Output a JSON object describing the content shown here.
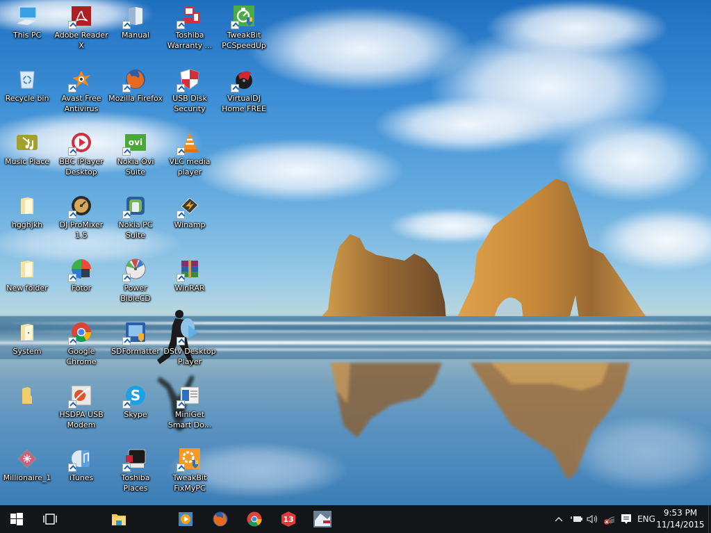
{
  "desktop": {
    "icons": [
      {
        "id": "this-pc",
        "label": "This PC",
        "shortcut": false
      },
      {
        "id": "adobe-reader",
        "label": "Adobe Reader X",
        "shortcut": true
      },
      {
        "id": "manual",
        "label": "Manual",
        "shortcut": true
      },
      {
        "id": "toshiba-warranty",
        "label": "Toshiba Warranty ...",
        "shortcut": true
      },
      {
        "id": "tweakbit-pcspeedup",
        "label": "TweakBit PCSpeedUp",
        "shortcut": true
      },
      {
        "id": "recycle-bin",
        "label": "Recycle bin",
        "shortcut": false
      },
      {
        "id": "avast",
        "label": "Avast Free Antivirus",
        "shortcut": true
      },
      {
        "id": "firefox",
        "label": "Mozilla Firefox",
        "shortcut": true
      },
      {
        "id": "usb-disk-security",
        "label": "USB Disk Security",
        "shortcut": true
      },
      {
        "id": "virtualdj",
        "label": "VirtualDJ Home FREE",
        "shortcut": true
      },
      {
        "id": "music-place",
        "label": "Music Place",
        "shortcut": false
      },
      {
        "id": "bbc-iplayer",
        "label": "BBC iPlayer Desktop",
        "shortcut": true
      },
      {
        "id": "nokia-ovi",
        "label": "Nokia Ovi Suite",
        "shortcut": true
      },
      {
        "id": "vlc",
        "label": "VLC media player",
        "shortcut": true
      },
      {
        "id": "hgghjkh",
        "label": "hgghjkh",
        "shortcut": false
      },
      {
        "id": "dj-promixer",
        "label": "DJ ProMixer 1.5",
        "shortcut": true
      },
      {
        "id": "nokia-pc-suite",
        "label": "Nokia PC Suite",
        "shortcut": true
      },
      {
        "id": "winamp",
        "label": "Winamp",
        "shortcut": true
      },
      {
        "id": "new-folder",
        "label": "New folder",
        "shortcut": false
      },
      {
        "id": "fotor",
        "label": "Fotor",
        "shortcut": true
      },
      {
        "id": "power-biblecd",
        "label": "Power BibleCD",
        "shortcut": true
      },
      {
        "id": "winrar",
        "label": "WinRAR",
        "shortcut": true
      },
      {
        "id": "system",
        "label": "System",
        "shortcut": false
      },
      {
        "id": "google-chrome",
        "label": "Google Chrome",
        "shortcut": true
      },
      {
        "id": "sdformatter",
        "label": "SDFormatter",
        "shortcut": true
      },
      {
        "id": "dstv",
        "label": "DStv Desktop Player",
        "shortcut": true
      },
      {
        "id": "unnamed-folder",
        "label": "",
        "shortcut": false
      },
      {
        "id": "hsdpa-modem",
        "label": "HSDPA USB Modem",
        "shortcut": true
      },
      {
        "id": "skype",
        "label": "Skype",
        "shortcut": true
      },
      {
        "id": "miniget",
        "label": "MiniGet Smart Do...",
        "shortcut": true
      },
      {
        "id": "millionaire",
        "label": "Millionaire_1",
        "shortcut": false
      },
      {
        "id": "itunes",
        "label": "iTunes",
        "shortcut": true
      },
      {
        "id": "toshiba-places",
        "label": "Toshiba Places",
        "shortcut": true
      },
      {
        "id": "tweakbit-fixmypc",
        "label": "TweakBit FixMyPC",
        "shortcut": true
      }
    ]
  },
  "taskbar": {
    "start": {
      "icon": "windows-logo-icon"
    },
    "task_view": {
      "icon": "task-view-icon"
    },
    "pinned": [
      {
        "id": "file-explorer",
        "icon": "file-explorer-icon"
      },
      {
        "id": "media-player",
        "icon": "media-player-icon"
      },
      {
        "id": "firefox",
        "icon": "firefox-icon"
      },
      {
        "id": "chrome",
        "icon": "chrome-icon"
      },
      {
        "id": "app-13",
        "icon": "app-13-icon",
        "badge_text": "13"
      },
      {
        "id": "game-app",
        "icon": "game-thumbnail-icon"
      }
    ],
    "tray": {
      "show_hidden": "^",
      "language": "ENG",
      "time": "9:53 PM",
      "date": "11/14/2015"
    }
  },
  "colors": {
    "taskbar_bg": "#121619",
    "accent": "#1a5fb4"
  }
}
